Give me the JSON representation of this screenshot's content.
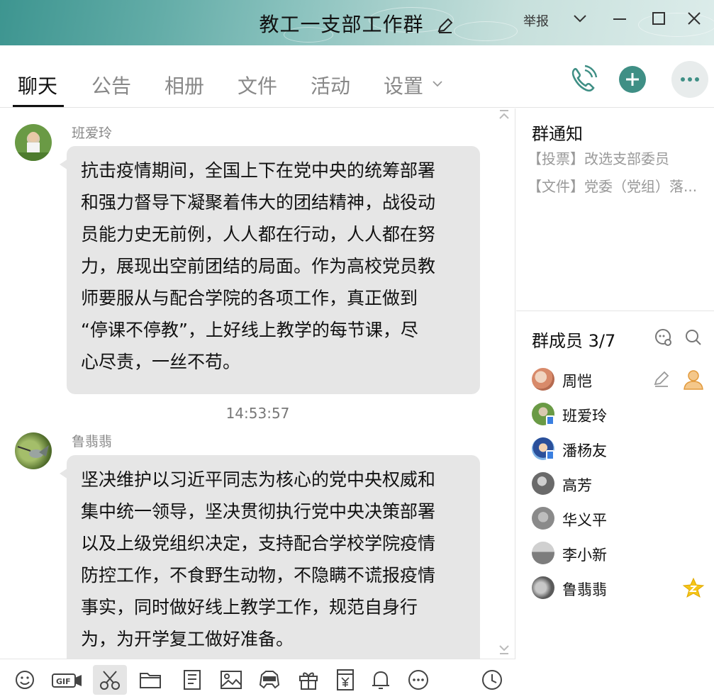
{
  "window": {
    "title": "教工一支部工作群",
    "report_label": "举报"
  },
  "tabs": [
    {
      "label": "聊天",
      "active": true
    },
    {
      "label": "公告"
    },
    {
      "label": "相册"
    },
    {
      "label": "文件"
    },
    {
      "label": "活动"
    },
    {
      "label": "设置"
    }
  ],
  "chat": {
    "messages": [
      {
        "sender": "班爱玲",
        "lines": [
          "抗击疫情期间，全国上下在党中央的统筹部署",
          "和强力督导下凝聚着伟大的团结精神，战役动",
          "员能力史无前例，人人都在行动，人人都在努",
          "力，展现出空前团结的局面。作为高校党员教",
          "师要服从与配合学院的各项工作，真正做到",
          "“停课不停教”，上好线上教学的每节课，尽",
          "心尽责，一丝不苟。"
        ]
      },
      {
        "timestamp": "14:53:57",
        "sender": "鲁翡翡",
        "lines": [
          "坚决维护以习近平同志为核心的党中央权威和",
          "集中统一领导，坚决贯彻执行党中央决策部署",
          "以及上级党组织决定，支持配合学校学院疫情",
          "防控工作，不食野生动物，不隐瞒不谎报疫情",
          "事实，同时做好线上教学工作，规范自身行",
          "为，为开学复工做好准备。"
        ]
      }
    ]
  },
  "toolbar": {
    "gif_label": "GIF",
    "icons": [
      "emoji-icon",
      "gif-icon",
      "scissors-icon",
      "folder-icon",
      "gallery-icon",
      "image-icon",
      "gamepad-icon",
      "gift-icon",
      "red-packet-icon",
      "bell-icon",
      "more-icon",
      "history-icon"
    ]
  },
  "sidebar": {
    "notice_title": "群通知",
    "notices": [
      "【投票】改选支部委员",
      "【文件】党委（党组）落..."
    ],
    "members_title": "群成员 3/7",
    "members": [
      {
        "name": "周恺"
      },
      {
        "name": "班爱玲"
      },
      {
        "name": "潘杨友"
      },
      {
        "name": "高芳"
      },
      {
        "name": "华义平"
      },
      {
        "name": "李小新"
      },
      {
        "name": "鲁翡翡"
      }
    ]
  },
  "colors": {
    "accent": "#3f8f85",
    "bubble": "#e6e6e6",
    "owner_star": "#f5c518"
  }
}
